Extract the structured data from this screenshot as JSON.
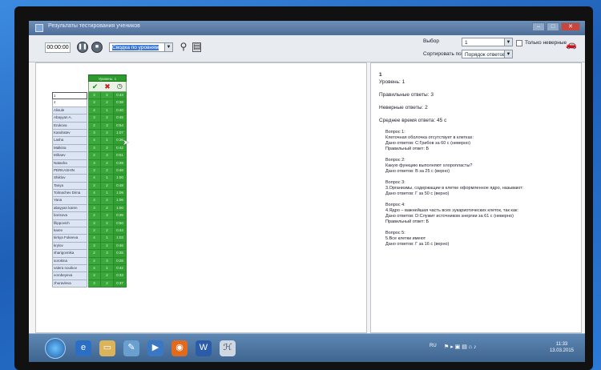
{
  "window": {
    "title": "Результаты тестирования учеников"
  },
  "toolbar": {
    "timer": "00:00:00",
    "report_select": "Сводка по уровням",
    "vybor_label": "Выбор",
    "vybor_value": "1",
    "sort_label": "Сортировать по",
    "sort_value": "Порядок ответов",
    "only_wrong_label": "Только неверные"
  },
  "grid": {
    "header": "Уровень: 1",
    "names": [
      "1",
      "2",
      "Alisule",
      "Abayyan A.",
      "Erukova",
      "Kandratev",
      "Lasha",
      "Malkina",
      "Mihaev",
      "Natasha",
      "PERKASHIN",
      "Shiklov",
      "Tanya",
      "Tolmachev Dima",
      "Yana",
      "abayyan karen",
      "borisova",
      "filippovich",
      "karev",
      "kirkya Fokeeva",
      "krylov",
      "sharigovnika",
      "sorokina",
      "valera nouikov",
      "vorobeyeva",
      "zhuravleva"
    ],
    "rows": [
      [
        "3",
        "2",
        "0:43"
      ],
      [
        "3",
        "2",
        "0:38"
      ],
      [
        "4",
        "1",
        "0:40"
      ],
      [
        "3",
        "2",
        "0:45"
      ],
      [
        "2",
        "3",
        "0:54"
      ],
      [
        "3",
        "2",
        "1:07"
      ],
      [
        "4",
        "1",
        "0:36"
      ],
      [
        "3",
        "2",
        "0:42"
      ],
      [
        "2",
        "3",
        "0:51"
      ],
      [
        "3",
        "2",
        "0:39"
      ],
      [
        "3",
        "2",
        "0:46"
      ],
      [
        "4",
        "1",
        "1:00"
      ],
      [
        "3",
        "2",
        "0:48"
      ],
      [
        "4",
        "1",
        "1:09"
      ],
      [
        "3",
        "2",
        "1:06"
      ],
      [
        "3",
        "2",
        "1:00"
      ],
      [
        "2",
        "3",
        "0:35"
      ],
      [
        "3",
        "2",
        "0:50"
      ],
      [
        "3",
        "2",
        "0:44"
      ],
      [
        "4",
        "1",
        "1:03"
      ],
      [
        "3",
        "2",
        "0:46"
      ],
      [
        "2",
        "3",
        "0:35"
      ],
      [
        "2",
        "3",
        "0:28"
      ],
      [
        "4",
        "1",
        "0:42"
      ],
      [
        "3",
        "2",
        "0:33"
      ],
      [
        "3",
        "2",
        "0:37"
      ]
    ]
  },
  "details": {
    "num": "1",
    "level": "Уровень: 1",
    "correct": "Правильные ответы: 3",
    "wrong": "Неверные ответы: 2",
    "avg_time": "Среднее время ответа: 45 с",
    "questions": [
      {
        "title": "Вопрос 1:",
        "lines": [
          "Клеточная оболочка отсутствует в клетках:",
          "Дано ответов: С:Грибов за 60 с (неверно)",
          "Правильный ответ: Б"
        ]
      },
      {
        "title": "Вопрос 2:",
        "lines": [
          "Какую функцию выполняют хлоропласты?",
          "Дано ответов: В за 25 с (верно)"
        ]
      },
      {
        "title": "Вопрос 3:",
        "lines": [
          "3.Организмы, содержащие в клетке оформленное ядро, называют:",
          "Дано ответов: Г за 50 с (верно)"
        ]
      },
      {
        "title": "Вопрос 4:",
        "lines": [
          "4.Ядро – важнейшая часть всех эукариотических клеток, так как:",
          "Дано ответов: D:Служит источником энергии за 61 с (неверно)",
          "Правильный ответ: Б"
        ]
      },
      {
        "title": "Вопрос 5:",
        "lines": [
          "5.Все клетки имеют",
          "Дано ответов: Г за 16 с (верно)"
        ]
      }
    ]
  },
  "taskbar": {
    "lang": "RU",
    "time": "11:33",
    "date": "13.03.2015"
  },
  "colors": {
    "grid_green": "#3aa83a",
    "header_green": "#2d9a2d",
    "taskbar": "#4a73a0"
  }
}
